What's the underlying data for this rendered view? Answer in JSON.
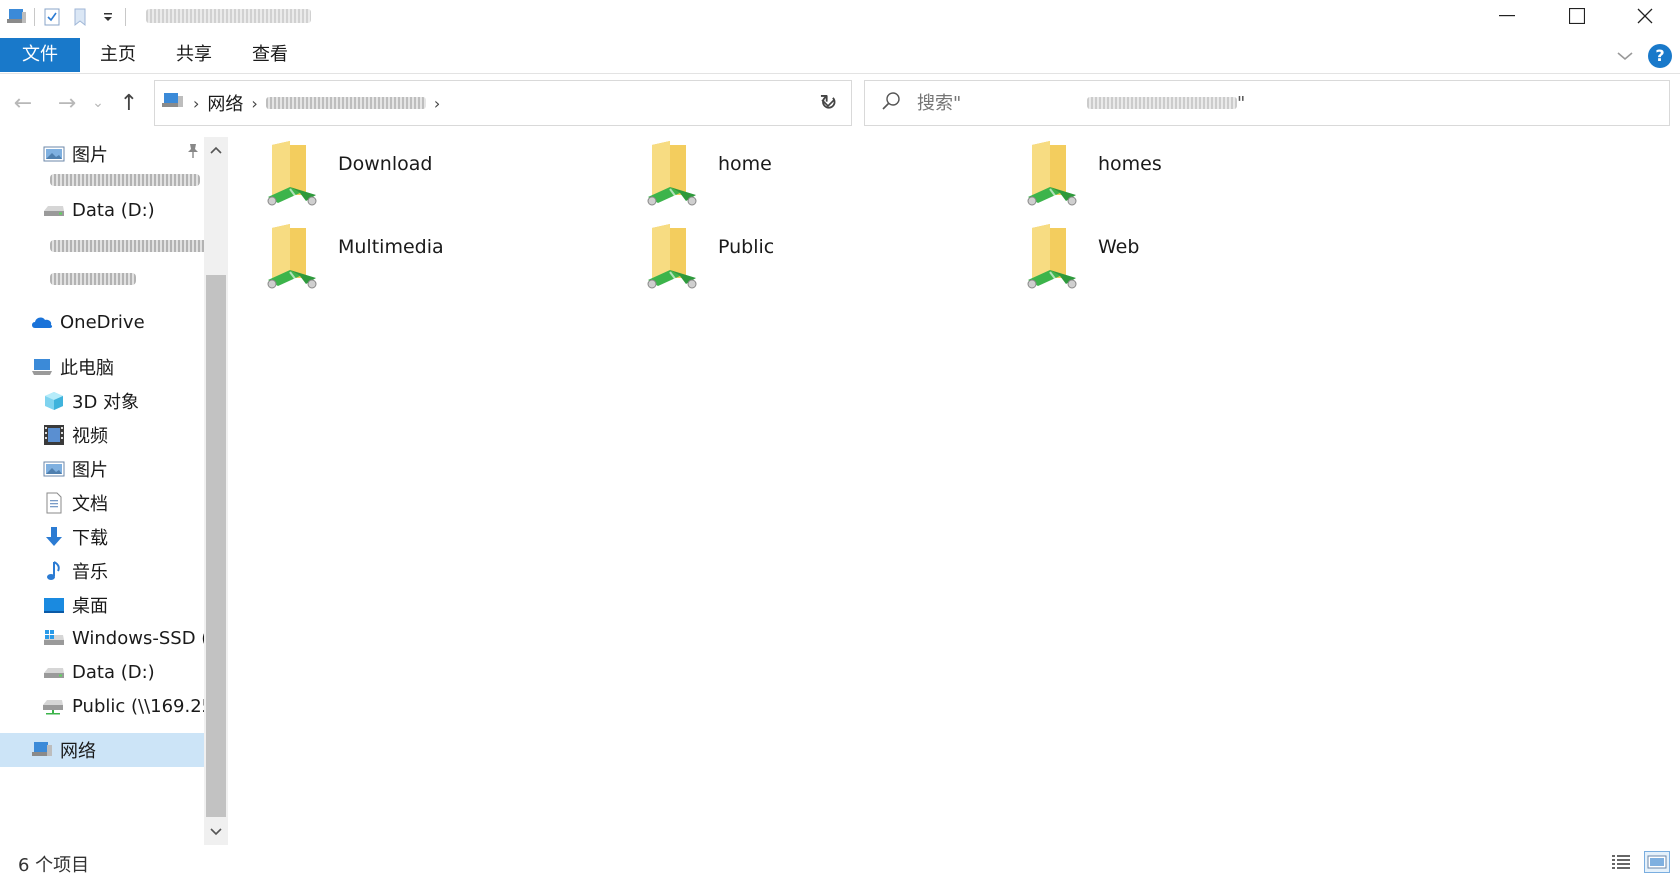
{
  "window": {
    "minimize_glyph": "—",
    "maximize_glyph": "☐",
    "close_glyph": "✕"
  },
  "ribbon": {
    "tabs": [
      {
        "label": "文件",
        "active": true
      },
      {
        "label": "主页"
      },
      {
        "label": "共享"
      },
      {
        "label": "查看"
      }
    ],
    "help_label": "?"
  },
  "nav": {
    "back_glyph": "←",
    "forward_glyph": "→",
    "recent_glyph": "⌄",
    "up_glyph": "↑",
    "refresh_glyph": "↻"
  },
  "address": {
    "crumbs": [
      "网络"
    ]
  },
  "search": {
    "placeholder": "搜索\"",
    "closing_quote": "\""
  },
  "sidebar": {
    "items": [
      {
        "label": "图片",
        "icon": "pictures-icon",
        "pinned": true
      },
      {
        "label": "Data (D:)",
        "icon": "drive-icon"
      },
      {
        "label": "OneDrive",
        "icon": "onedrive-cloud-icon"
      },
      {
        "label": "此电脑",
        "icon": "this-pc-icon"
      },
      {
        "label": "3D 对象",
        "icon": "3d-objects-icon"
      },
      {
        "label": "视频",
        "icon": "videos-icon"
      },
      {
        "label": "图片",
        "icon": "pictures-icon"
      },
      {
        "label": "文档",
        "icon": "documents-icon"
      },
      {
        "label": "下载",
        "icon": "downloads-icon"
      },
      {
        "label": "音乐",
        "icon": "music-icon"
      },
      {
        "label": "桌面",
        "icon": "desktop-icon"
      },
      {
        "label": "Windows-SSD (",
        "icon": "windows-drive-icon"
      },
      {
        "label": "Data (D:)",
        "icon": "drive-icon"
      },
      {
        "label": "Public (\\\\169.25",
        "icon": "network-drive-icon"
      },
      {
        "label": "网络",
        "icon": "network-icon",
        "selected": true
      }
    ]
  },
  "content": {
    "folders": [
      {
        "name": "Download"
      },
      {
        "name": "home"
      },
      {
        "name": "homes"
      },
      {
        "name": "Multimedia"
      },
      {
        "name": "Public"
      },
      {
        "name": "Web"
      }
    ]
  },
  "status": {
    "item_count": "6 个项目"
  },
  "colors": {
    "accent": "#1979ca",
    "selected_bg": "#cce4f7",
    "folder_yellow": "#f3cd5e",
    "share_green": "#3cb44b"
  }
}
